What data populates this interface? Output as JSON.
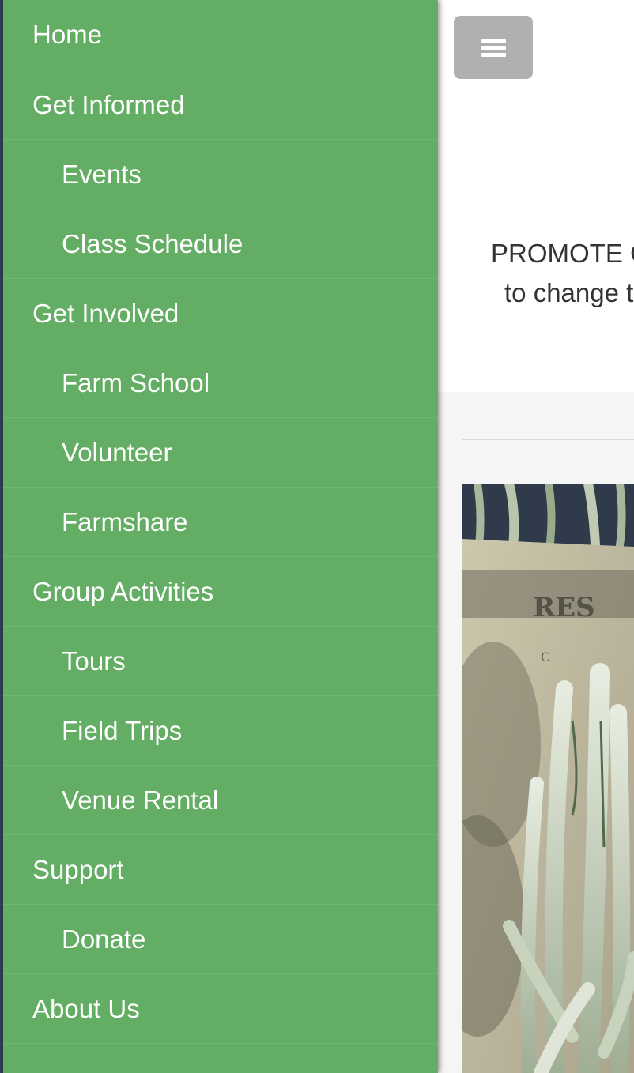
{
  "sidebar": {
    "items": [
      {
        "label": "Home",
        "level": "top"
      },
      {
        "label": "Get Informed",
        "level": "top"
      },
      {
        "label": "Events",
        "level": "sub"
      },
      {
        "label": "Class Schedule",
        "level": "sub"
      },
      {
        "label": "Get Involved",
        "level": "top"
      },
      {
        "label": "Farm School",
        "level": "sub"
      },
      {
        "label": "Volunteer",
        "level": "sub"
      },
      {
        "label": "Farmshare",
        "level": "sub"
      },
      {
        "label": "Group Activities",
        "level": "top"
      },
      {
        "label": "Tours",
        "level": "sub"
      },
      {
        "label": "Field Trips",
        "level": "sub"
      },
      {
        "label": "Venue Rental",
        "level": "sub"
      },
      {
        "label": "Support",
        "level": "top"
      },
      {
        "label": "Donate",
        "level": "sub"
      },
      {
        "label": "About Us",
        "level": "top"
      }
    ]
  },
  "header": {
    "menu_icon": "hamburger-menu-icon"
  },
  "hero": {
    "line1": "PROMOTE CO",
    "line2": "to change t"
  },
  "colors": {
    "sidebar_bg": "#64ad64",
    "menu_button_bg": "#b0b0b0"
  }
}
